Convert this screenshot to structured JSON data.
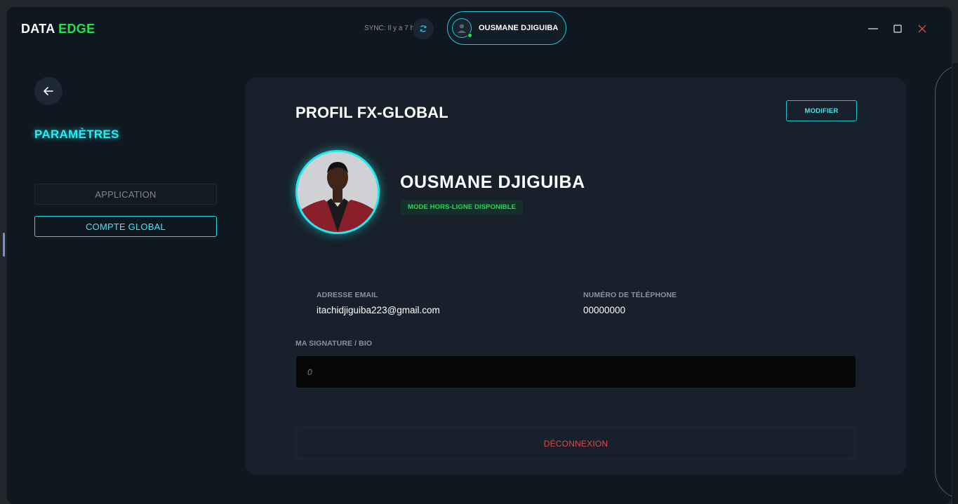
{
  "app": {
    "brand_main": "DATA",
    "brand_accent": "EDGE",
    "sync_text": "SYNC: Il y a 7 h",
    "user_chip_name": "OUSMANE DJIGUIBA"
  },
  "sidebar": {
    "title": "PARAMÈTRES",
    "items": [
      {
        "label": "APPLICATION",
        "active": false
      },
      {
        "label": "COMPTE GLOBAL",
        "active": true
      }
    ]
  },
  "profile": {
    "title": "PROFIL FX-GLOBAL",
    "modify_label": "MODIFIER",
    "name": "OUSMANE DJIGUIBA",
    "status_badge": "MODE HORS-LIGNE DISPONIBLE",
    "email_label": "ADRESSE EMAIL",
    "email_value": "itachidjiguiba223@gmail.com",
    "phone_label": "NUMÉRO DE TÉLÉPHONE",
    "phone_value": "00000000",
    "bio_label": "MA SIGNATURE / BIO",
    "bio_value": "0",
    "logout_label": "DÉCONNEXION"
  },
  "icons": {
    "back": "arrow-left-icon",
    "sync": "refresh-icon",
    "minimize": "minimize-icon",
    "maximize": "maximize-icon",
    "close": "close-icon"
  },
  "colors": {
    "accent_cyan": "#22f0f5",
    "accent_green": "#22e14b",
    "danger": "#e04848",
    "background": "#0f1821",
    "card": "#18212b"
  }
}
